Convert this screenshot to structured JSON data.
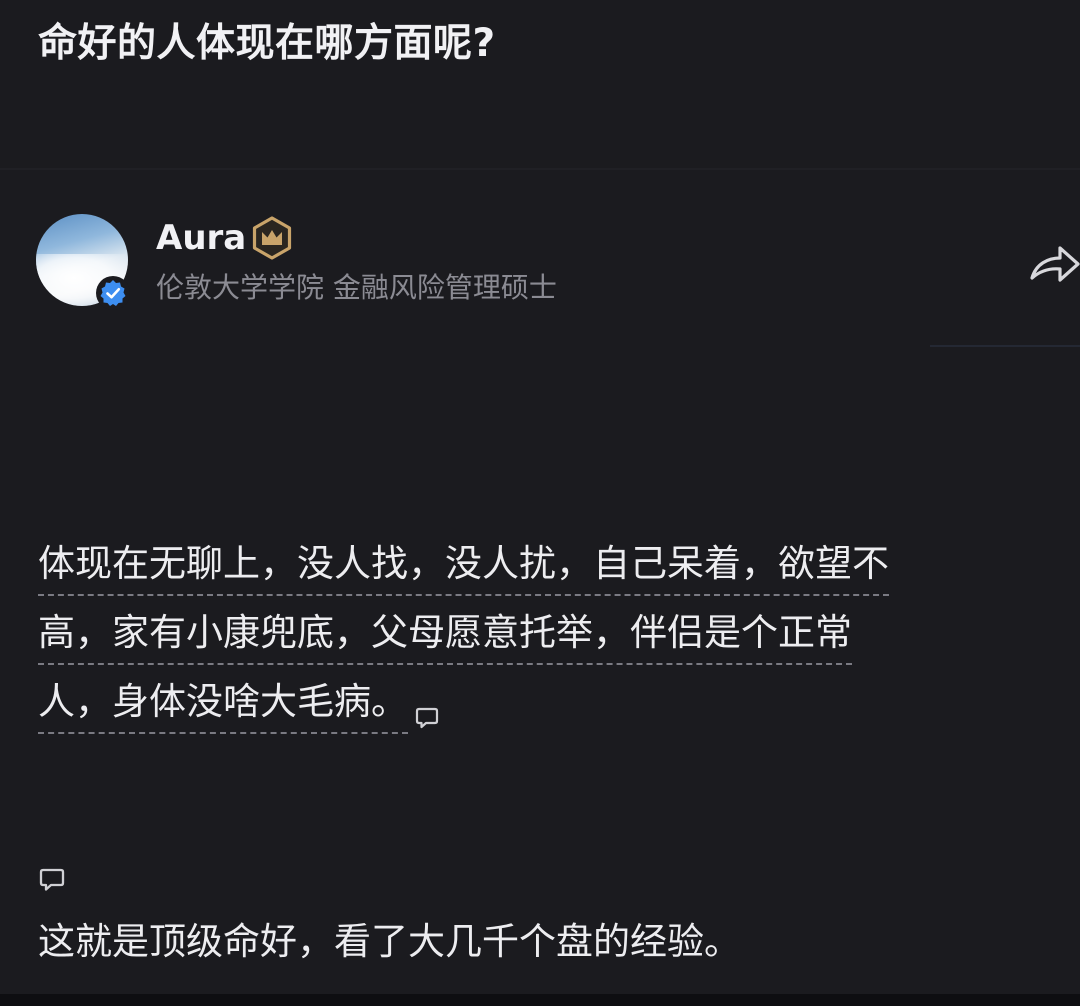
{
  "question": {
    "title": "命好的人体现在哪方面呢?"
  },
  "author": {
    "name": "Aura",
    "bio": "伦敦大学学院 金融风险管理硕士",
    "verified": true,
    "badge_icon": "crown-badge-icon"
  },
  "answer": {
    "lines": [
      "体现在无聊上，没人找，没人扰，自己呆着，欲望不",
      "高，家有小康兜底，父母愿意托举，伴侣是个正常",
      "人，身体没啥大毛病。"
    ],
    "closing": "这就是顶级命好，看了大几千个盘的经验。"
  },
  "icons": {
    "share": "share-icon",
    "comment": "comment-icon",
    "verified": "verified-check-icon"
  },
  "colors": {
    "background": "#1b1b1f",
    "text": "#ededf0",
    "muted": "#8b8b93",
    "verified_blue": "#3d8ef0",
    "badge_gold": "#c9a46a"
  }
}
